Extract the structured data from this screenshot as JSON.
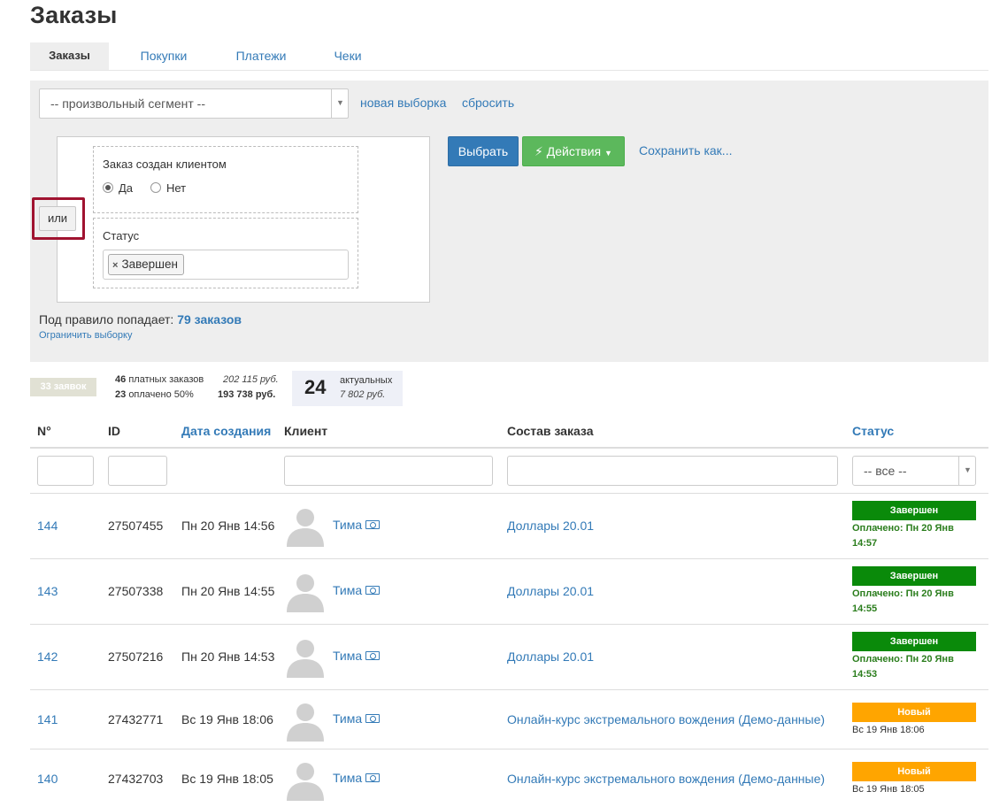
{
  "page": {
    "title": "Заказы"
  },
  "tabs": [
    {
      "label": "Заказы",
      "active": true
    },
    {
      "label": "Покупки",
      "active": false
    },
    {
      "label": "Платежи",
      "active": false
    },
    {
      "label": "Чеки",
      "active": false
    }
  ],
  "filter": {
    "segment_value": "-- произвольный сегмент --",
    "new_selection_link": "новая выборка",
    "reset_link": "сбросить",
    "or_button": "или",
    "condition_created_by_client": {
      "title": "Заказ создан клиентом",
      "option_yes": "Да",
      "option_no": "Нет",
      "selected": "Да"
    },
    "condition_status": {
      "title": "Статус",
      "tag": "Завершен",
      "tag_remove": "×"
    },
    "select_button": "Выбрать",
    "actions_button": "Действия",
    "save_link": "Сохранить как...",
    "match_prefix": "Под правило попадает:",
    "match_count": "79 заказов",
    "limit_link": "Ограничить выборку"
  },
  "stats": {
    "badge": "33 заявок",
    "paid_count": "46",
    "paid_label": "платных заказов",
    "paid_sum": "202 115 руб.",
    "paid_done_count": "23",
    "paid_done_label": "оплачено 50%",
    "paid_done_sum": "193 738 руб.",
    "actual_count": "24",
    "actual_label": "актуальных",
    "actual_sum": "7 802 руб."
  },
  "table": {
    "headers": {
      "num": "N°",
      "id": "ID",
      "created": "Дата создания",
      "client": "Клиент",
      "composition": "Состав заказа",
      "status": "Статус"
    },
    "status_filter_value": "-- все --",
    "rows": [
      {
        "num": "144",
        "id": "27507455",
        "date": "Пн 20 Янв 14:56",
        "client": "Тима",
        "composition": "Доллары 20.01",
        "status": "Завершен",
        "status_color": "#0a8a0a",
        "paid_line1": "Оплачено: Пн 20 Янв",
        "paid_line2": "14:57"
      },
      {
        "num": "143",
        "id": "27507338",
        "date": "Пн 20 Янв 14:55",
        "client": "Тима",
        "composition": "Доллары 20.01",
        "status": "Завершен",
        "status_color": "#0a8a0a",
        "paid_line1": "Оплачено: Пн 20 Янв",
        "paid_line2": "14:55"
      },
      {
        "num": "142",
        "id": "27507216",
        "date": "Пн 20 Янв 14:53",
        "client": "Тима",
        "composition": "Доллары 20.01",
        "status": "Завершен",
        "status_color": "#0a8a0a",
        "paid_line1": "Оплачено: Пн 20 Янв",
        "paid_line2": "14:53"
      },
      {
        "num": "141",
        "id": "27432771",
        "date": "Вс 19 Янв 18:06",
        "client": "Тима",
        "composition": "Онлайн-курс экстремального вождения (Демо-данные)",
        "status": "Новый",
        "status_color": "#ffa500",
        "status_date": "Вс 19 Янв 18:06"
      },
      {
        "num": "140",
        "id": "27432703",
        "date": "Вс 19 Янв 18:05",
        "client": "Тима",
        "composition": "Онлайн-курс экстремального вождения (Демо-данные)",
        "status": "Новый",
        "status_color": "#ffa500",
        "status_date": "Вс 19 Янв 18:05"
      }
    ]
  },
  "colors": {
    "primary": "#337ab7",
    "success": "#5cb85c",
    "status_done": "#0a8a0a",
    "status_new": "#ffa500",
    "highlight": "#a01330"
  }
}
